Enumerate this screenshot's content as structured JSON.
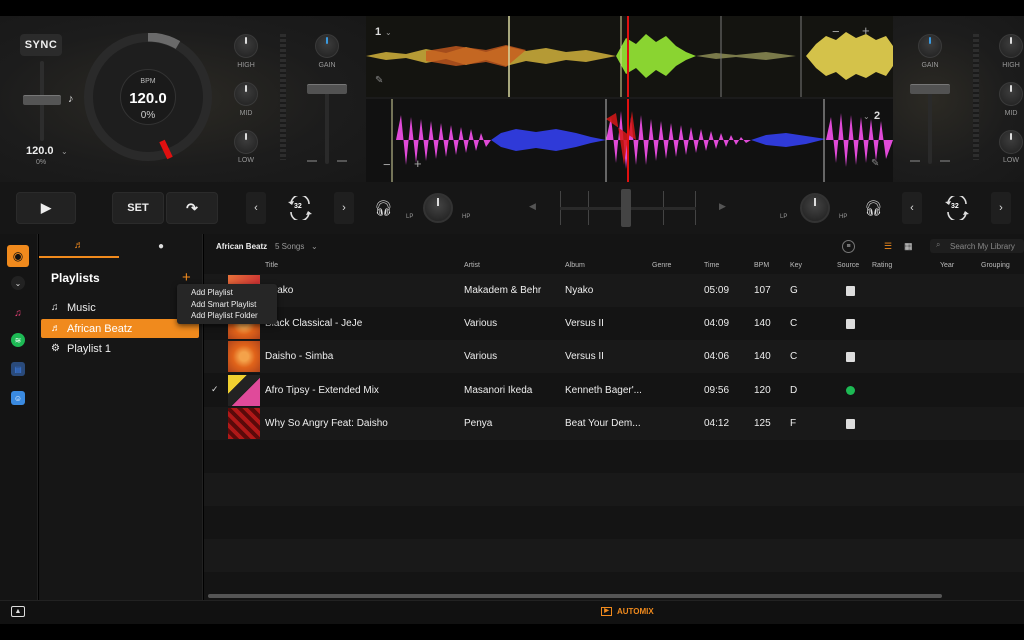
{
  "deck1": {
    "sync_label": "SYNC",
    "bpm_label": "BPM",
    "bpm_value": "120.0",
    "bpm_percent": "0%",
    "pitch_value": "120.0",
    "pitch_percent": "0%",
    "number": "1"
  },
  "deck2": {
    "number": "2"
  },
  "mixer": {
    "high_label": "HIGH",
    "mid_label": "MID",
    "low_label": "LOW",
    "gain_label": "GAIN"
  },
  "waveform": {
    "minus": "−",
    "plus": "+"
  },
  "transport": {
    "play": "▶",
    "set": "SET",
    "loop_size_left": "32",
    "loop_size_right": "32",
    "lp_label": "LP",
    "hp_label": "HP"
  },
  "sidebar": {
    "heading": "Playlists",
    "items": [
      {
        "label": "Music",
        "icon": "music-note-icon"
      },
      {
        "label": "African Beatz",
        "icon": "playlist-icon",
        "selected": true
      },
      {
        "label": "Playlist 1",
        "icon": "gear-icon"
      }
    ],
    "menu": [
      "Add Playlist",
      "Add Smart Playlist",
      "Add Playlist Folder"
    ]
  },
  "library": {
    "breadcrumb": "African Beatz",
    "song_count": "5 Songs",
    "search_placeholder": "Search My Library",
    "columns": [
      "Title",
      "Artist",
      "Album",
      "Genre",
      "Time",
      "BPM",
      "Key",
      "Source",
      "Rating",
      "Year",
      "Grouping"
    ],
    "tracks": [
      {
        "title": "Nyako",
        "artist": "Makadem & Behr",
        "album": "Nyako",
        "time": "05:09",
        "bpm": "107",
        "key": "G",
        "source": "file",
        "checked": false
      },
      {
        "title": "Black Classical - JeJe",
        "artist": "Various",
        "album": "Versus II",
        "time": "04:09",
        "bpm": "140",
        "key": "C",
        "source": "file",
        "checked": false
      },
      {
        "title": "Daisho - Simba",
        "artist": "Various",
        "album": "Versus II",
        "time": "04:06",
        "bpm": "140",
        "key": "C",
        "source": "file",
        "checked": false
      },
      {
        "title": "Afro Tipsy - Extended Mix",
        "artist": "Masanori Ikeda",
        "album": "Kenneth Bager'...",
        "time": "09:56",
        "bpm": "120",
        "key": "D",
        "source": "spotify",
        "checked": true
      },
      {
        "title": "Why So Angry Feat: Daisho",
        "artist": "Penya",
        "album": "Beat Your Dem...",
        "time": "04:12",
        "bpm": "125",
        "key": "F",
        "source": "file",
        "checked": false
      }
    ]
  },
  "footer": {
    "automix_label": "AUTOMIX"
  },
  "colors": {
    "accent": "#f08a1d",
    "spotify": "#1db954",
    "waveform_top": "#d4c24a",
    "waveform_bottom_pink": "#e04ad8",
    "waveform_bottom_blue": "#2f3ad8",
    "playhead": "#e01010"
  }
}
